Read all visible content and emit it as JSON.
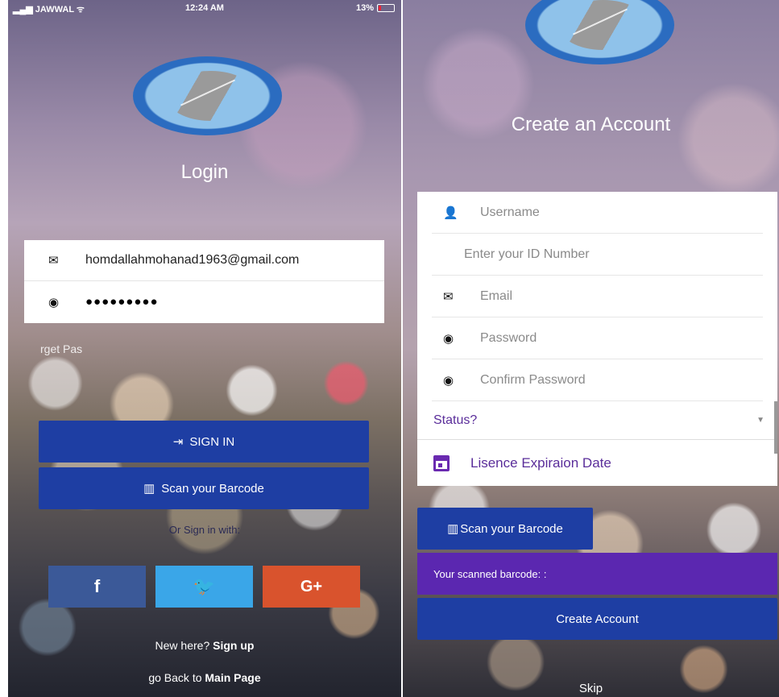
{
  "login": {
    "status_bar": {
      "carrier": "JAWWAL",
      "time": "12:24 AM",
      "battery": "13%"
    },
    "title": "Login",
    "email_value": "homdallahmohanad1963@gmail.com",
    "password_value": "●●●●●●●●●",
    "forgot_text": "rget Pas",
    "sign_in_label": "SIGN IN",
    "scan_label": "Scan your Barcode",
    "or_sign_in_with": "Or Sign in with:",
    "social": {
      "facebook": "f",
      "twitter": "🐦",
      "google": "G+"
    },
    "new_here": "New here?",
    "sign_up": "Sign up",
    "go_back": "go Back to",
    "main_page": "Main Page"
  },
  "register": {
    "title": "Create an Account",
    "username_placeholder": "Username",
    "id_placeholder": "Enter your ID Number",
    "email_placeholder": "Email",
    "password_placeholder": "Password",
    "confirm_placeholder": "Confirm Password",
    "status_label": "Status?",
    "license_label": "Lisence Expiraion Date",
    "scan_label": "Scan your Barcode",
    "scanned_label": "Your scanned barcode: :",
    "create_label": "Create Account",
    "skip_label": "Skip"
  },
  "colors": {
    "primary_blue": "#1e3ea3",
    "purple": "#5b27b0",
    "facebook": "#3b5998",
    "twitter": "#1da1f2",
    "google": "#dd4b39"
  }
}
